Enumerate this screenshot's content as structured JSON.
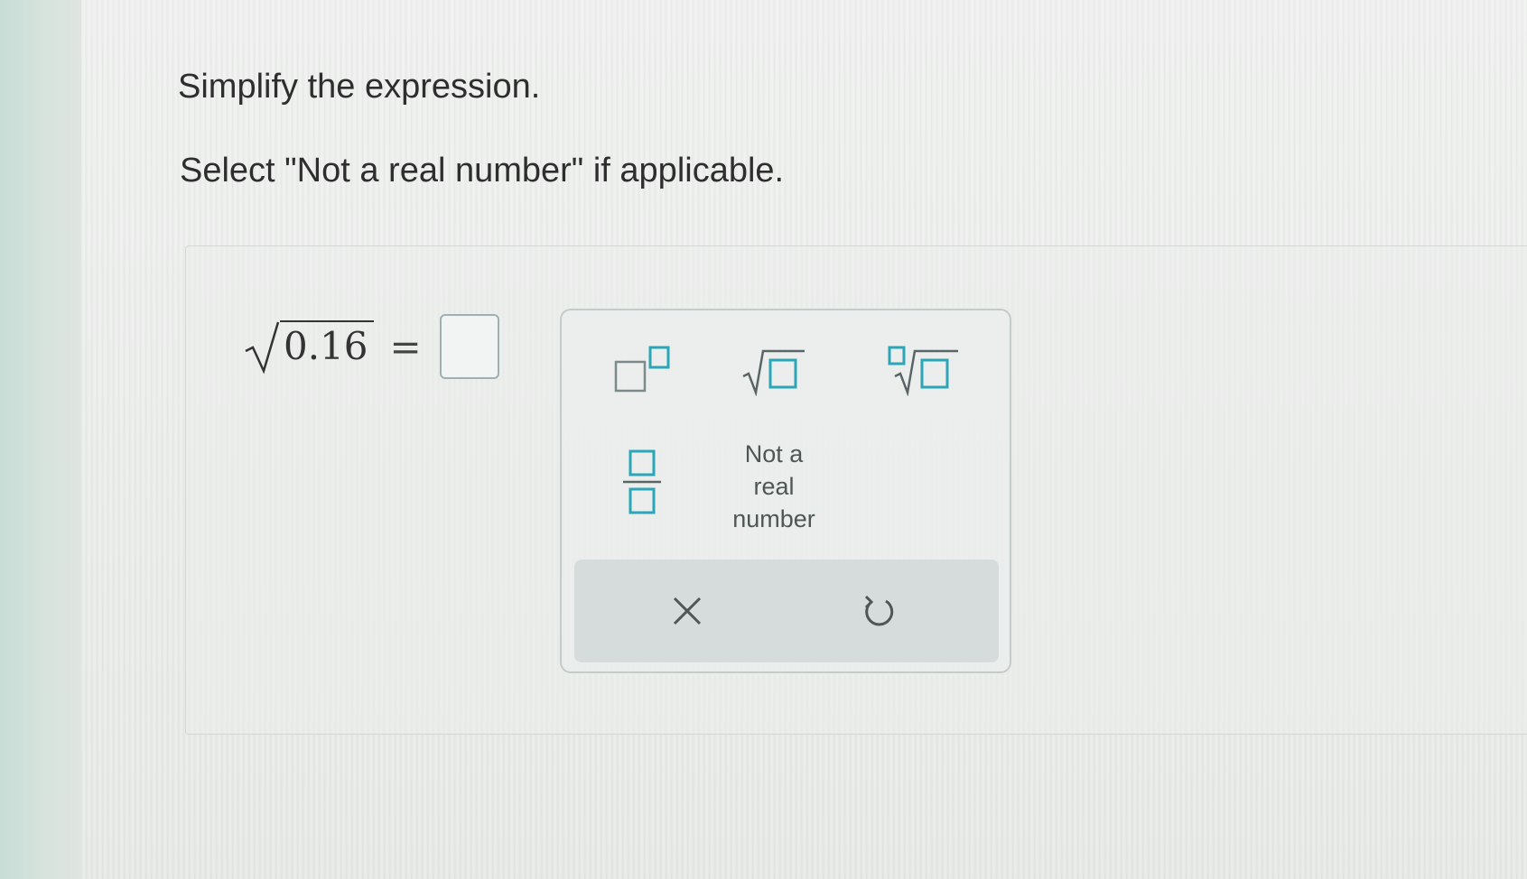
{
  "question": {
    "title": "Simplify the expression.",
    "instruction": "Select \"Not a real number\" if applicable."
  },
  "expression": {
    "radicand": "0.16",
    "equals": "="
  },
  "keypad": {
    "keys": [
      {
        "name": "superscript-key",
        "icon": "superscript-template-icon"
      },
      {
        "name": "square-root-key",
        "icon": "square-root-template-icon"
      },
      {
        "name": "nth-root-key",
        "icon": "nth-root-template-icon"
      },
      {
        "name": "fraction-key",
        "icon": "fraction-template-icon"
      },
      {
        "name": "not-real-number-key",
        "lines": [
          "Not a",
          "real",
          "number"
        ]
      }
    ],
    "actions": [
      {
        "name": "clear-button",
        "icon": "x-icon"
      },
      {
        "name": "undo-button",
        "icon": "undo-icon"
      }
    ],
    "accent_color": "#2aa6b8"
  }
}
